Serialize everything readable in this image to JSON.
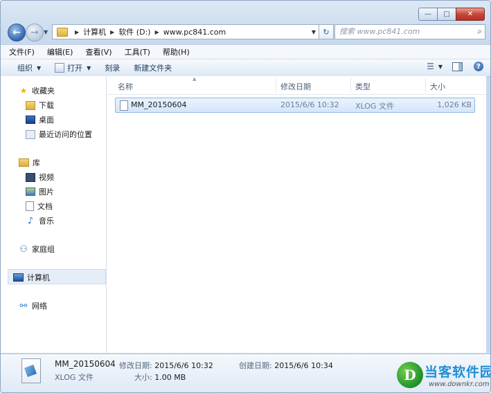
{
  "window": {
    "caption": {
      "minimize": "—",
      "maximize": "□",
      "close": "✕"
    }
  },
  "navigation": {
    "back_glyph": "←",
    "forward_glyph": "→",
    "address": {
      "crumbs": [
        "计算机",
        "软件 (D:)",
        "www.pc841.com"
      ]
    },
    "search": {
      "placeholder": "搜索 www.pc841.com"
    }
  },
  "menubar": {
    "items": [
      "文件(F)",
      "编辑(E)",
      "查看(V)",
      "工具(T)",
      "帮助(H)"
    ]
  },
  "toolbar": {
    "organize": "组织",
    "open": "打开",
    "burn": "刻录",
    "new_folder": "新建文件夹",
    "help_glyph": "?"
  },
  "navpane": {
    "favorites": {
      "label": "收藏夹",
      "items": [
        "下载",
        "桌面",
        "最近访问的位置"
      ]
    },
    "libraries": {
      "label": "库",
      "items": [
        "视频",
        "图片",
        "文档",
        "音乐"
      ]
    },
    "homegroup": "家庭组",
    "computer": "计算机",
    "network": "网络"
  },
  "columns": [
    "名称",
    "修改日期",
    "类型",
    "大小"
  ],
  "files": [
    {
      "name": "MM_20150604",
      "modified": "2015/6/6 10:32",
      "type": "XLOG 文件",
      "size": "1,026 KB"
    }
  ],
  "details": {
    "name": "MM_20150604",
    "type": "XLOG 文件",
    "modified_label": "修改日期:",
    "modified": "2015/6/6 10:32",
    "created_label": "创建日期:",
    "created": "2015/6/6 10:34",
    "size_label": "大小:",
    "size": "1.00 MB"
  },
  "watermark": {
    "title": "当客软件园",
    "url": "www.downkr.com"
  },
  "icons": {
    "favorites": "star-icon",
    "downloads": "folder-icon",
    "desktop": "desktop-icon",
    "recent": "recent-places-icon",
    "libraries": "library-icon",
    "video": "video-icon",
    "pictures": "pictures-icon",
    "documents": "document-icon",
    "music": "music-icon",
    "homegroup": "homegroup-icon",
    "computer": "computer-icon",
    "network": "network-icon"
  },
  "colors": {
    "accent": "#1e395b",
    "selection": "#d4e6fb",
    "close_button": "#c6463a"
  }
}
